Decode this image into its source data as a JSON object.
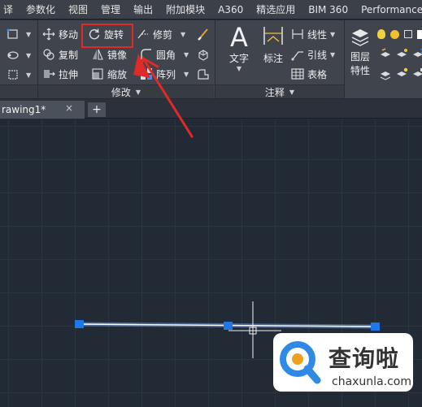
{
  "menubar": {
    "items": [
      "译",
      "参数化",
      "视图",
      "管理",
      "输出",
      "附加模块",
      "A360",
      "精选应用",
      "BIM 360",
      "Performance"
    ]
  },
  "ribbon": {
    "modify_panel": {
      "title": "修改",
      "move": "移动",
      "rotate": "旋转",
      "trim": "修剪",
      "copy": "复制",
      "mirror": "镜像",
      "fillet": "圆角",
      "stretch": "拉伸",
      "scale": "缩放",
      "array": "阵列"
    },
    "annotation_panel": {
      "title": "注释",
      "text": "文字",
      "dimension": "标注",
      "linear": "线性",
      "leader": "引线",
      "table": "表格"
    },
    "layers_panel": {
      "properties_l1": "图层",
      "properties_l2": "特性"
    }
  },
  "tabs": {
    "doc_tab": "rawing1*",
    "close": "×",
    "new": "+"
  },
  "watermark": {
    "brand": "查询啦",
    "url": "chaxunla.com"
  },
  "colors": {
    "highlight": "#e02a2a",
    "arrow": "#e02a2a",
    "grip": "#1e78e6",
    "line": "#ffffff",
    "canvas": "#222a36"
  }
}
